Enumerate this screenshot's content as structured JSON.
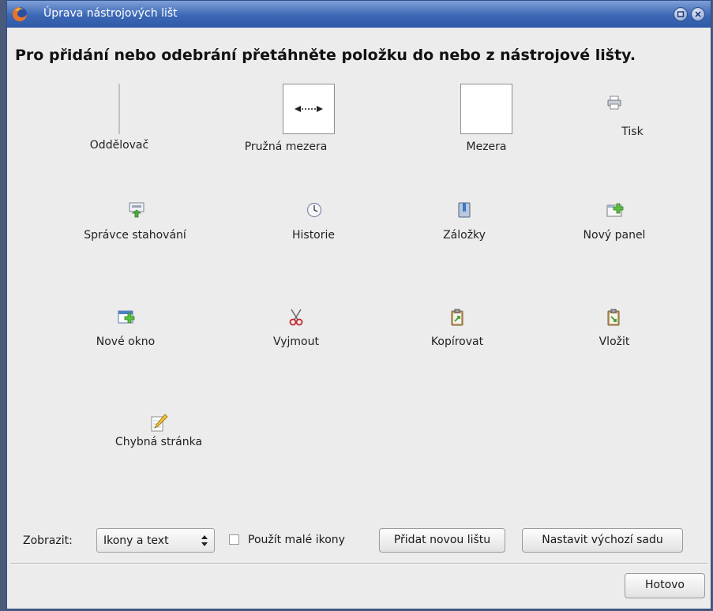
{
  "window": {
    "title": "Úprava nástrojových lišt"
  },
  "heading": "Pro přidání nebo odebrání přetáhněte položku do nebo z nástrojové lišty.",
  "items": [
    {
      "label": "Oddělovač",
      "icon": "separator-icon"
    },
    {
      "label": "Pružná mezera",
      "icon": "flexible-space-icon"
    },
    {
      "label": "Mezera",
      "icon": "space-icon"
    },
    {
      "label": "Tisk",
      "icon": "printer-icon"
    },
    {
      "label": "Správce stahování",
      "icon": "downloads-icon"
    },
    {
      "label": "Historie",
      "icon": "clock-icon"
    },
    {
      "label": "Záložky",
      "icon": "bookmarks-icon"
    },
    {
      "label": "Nový panel",
      "icon": "new-tab-icon"
    },
    {
      "label": "Nové okno",
      "icon": "new-window-icon"
    },
    {
      "label": "Vyjmout",
      "icon": "scissors-icon"
    },
    {
      "label": "Kopírovat",
      "icon": "copy-icon"
    },
    {
      "label": "Vložit",
      "icon": "paste-icon"
    },
    {
      "label": "Chybná stránka",
      "icon": "pencil-icon"
    }
  ],
  "bottom": {
    "show_label": "Zobrazit:",
    "show_value": "Ikony a text",
    "small_icons_label": "Použít malé ikony",
    "small_icons_checked": false,
    "add_toolbar_label": "Přidat novou lištu",
    "restore_default_label": "Nastavit výchozí sadu"
  },
  "footer": {
    "done_label": "Hotovo"
  }
}
